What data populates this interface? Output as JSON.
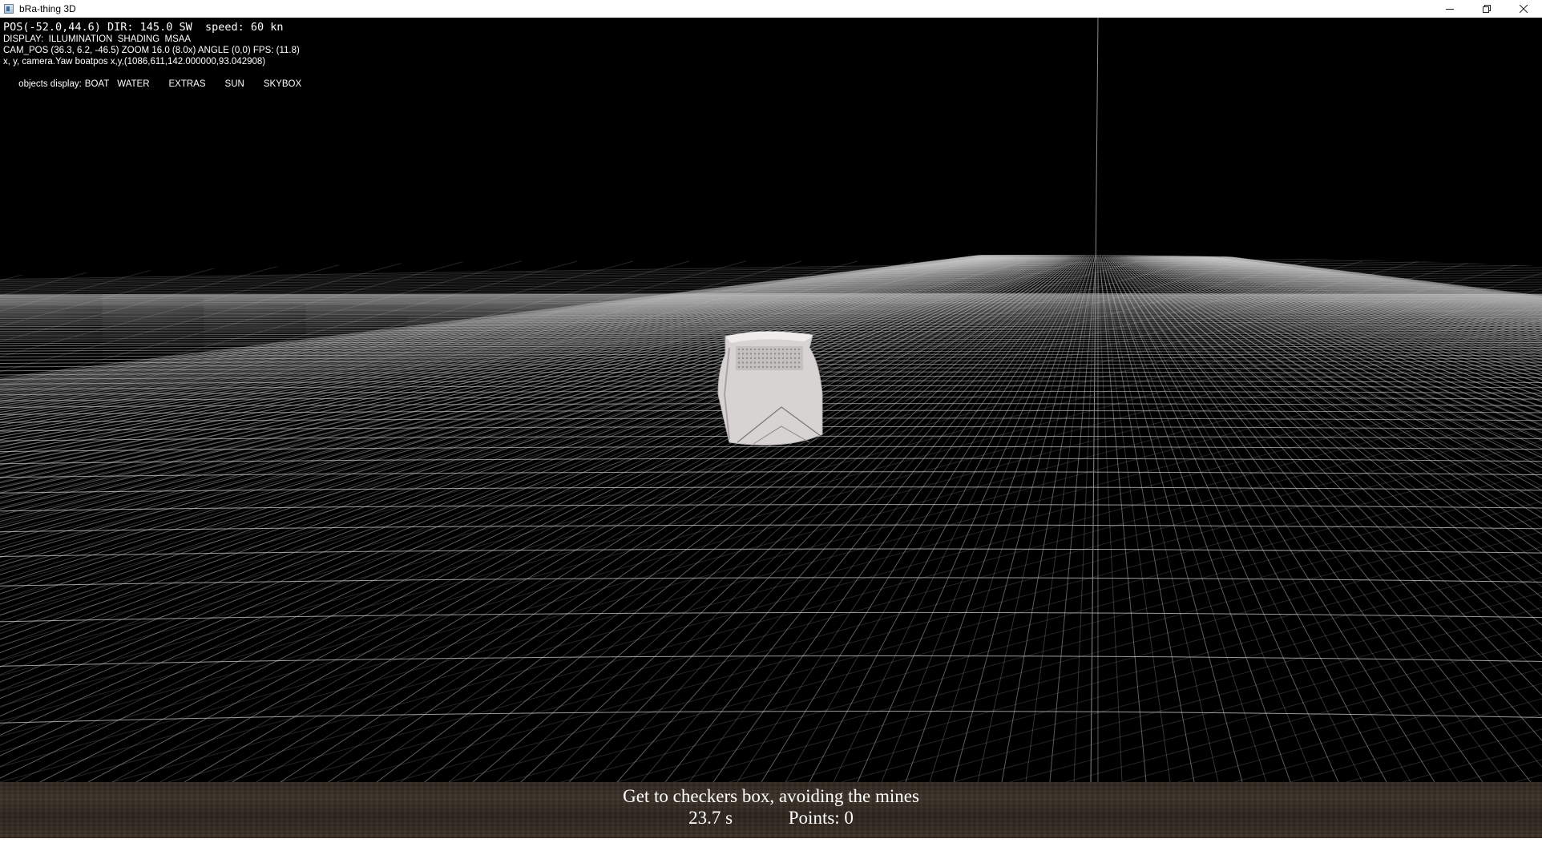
{
  "window": {
    "title": "bRa-thing 3D",
    "controls": {
      "minimize": "—",
      "restore": "❐",
      "close": "✕"
    }
  },
  "hud": {
    "line1": "POS(-52.0,44.6) DIR: 145.0 SW  speed: 60 kn",
    "line2": "DISPLAY:  ILLUMINATION  SHADING  MSAA",
    "line3": "CAM_POS (36.3, 6.2, -46.5) ZOOM 16.0 (8.0x) ANGLE (0,0) FPS: (11.8)",
    "line4": "x, y, camera.Yaw boatpos x,y,(1086,611,142.000000,93.042908)",
    "objects_label": "objects display:",
    "objects": [
      "BOAT",
      "WATER",
      "EXTRAS",
      "SUN",
      "SKYBOX"
    ]
  },
  "message": {
    "objective": "Get to checkers box, avoiding the mines",
    "time": "23.7 s",
    "points": "Points: 0"
  },
  "colors": {
    "background": "#000000",
    "grid": "#cfcfcf",
    "boat": "#dcd8d8",
    "message_bar": "#33291f",
    "text": "#ffffff"
  }
}
